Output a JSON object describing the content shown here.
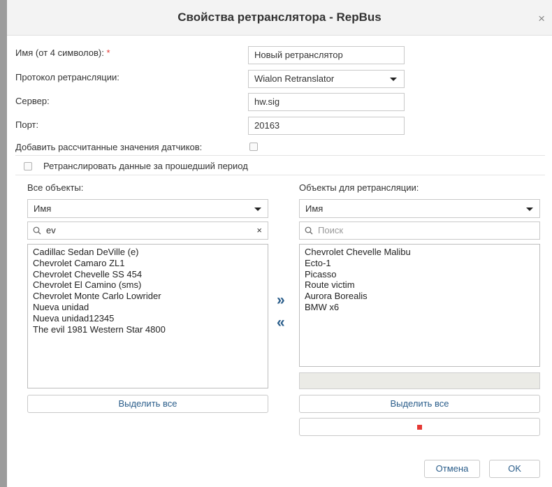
{
  "dialog": {
    "title": "Свойства ретранслятора - RepBus",
    "close_symbol": "×"
  },
  "form": {
    "name_label": "Имя (от 4 символов):",
    "required_mark": "*",
    "name_value": "Новый ретранслятор",
    "protocol_label": "Протокол ретрансляции:",
    "protocol_value": "Wialon Retranslator",
    "server_label": "Сервер:",
    "server_value": "hw.sig",
    "port_label": "Порт:",
    "port_value": "20163",
    "add_sensors_label": "Добавить рассчитанные значения датчиков:",
    "add_sensors_checked": false,
    "retranslate_past_label": "Ретранслировать данные за прошедший период",
    "retranslate_past_checked": false
  },
  "left_panel": {
    "label": "Все объекты:",
    "sort_value": "Имя",
    "search_value": "ev",
    "clear_symbol": "×",
    "items": [
      "Cadillac Sedan DeVille (e)",
      "Chevrolet Camaro ZL1",
      "Chevrolet Chevelle SS 454",
      "Chevrolet El Camino (sms)",
      "Chevrolet Monte Carlo Lowrider",
      "Nueva unidad",
      "Nueva unidad12345",
      "The evil 1981 Western Star 4800"
    ],
    "select_all_label": "Выделить все"
  },
  "transfer": {
    "add_symbol": "»",
    "remove_symbol": "«"
  },
  "right_panel": {
    "label": "Объекты для ретрансляции:",
    "sort_value": "Имя",
    "search_placeholder": "Поиск",
    "items": [
      "Chevrolet Chevelle Malibu",
      "Ecto-1",
      "Picasso",
      "Route victim",
      "Aurora Borealis",
      "BMW x6"
    ],
    "select_all_label": "Выделить все"
  },
  "footer": {
    "cancel_label": "Отмена",
    "ok_label": "OK"
  },
  "colors": {
    "accent_text": "#2a5d8a",
    "required": "#e53935",
    "title_bar": "#f3f3f3"
  }
}
